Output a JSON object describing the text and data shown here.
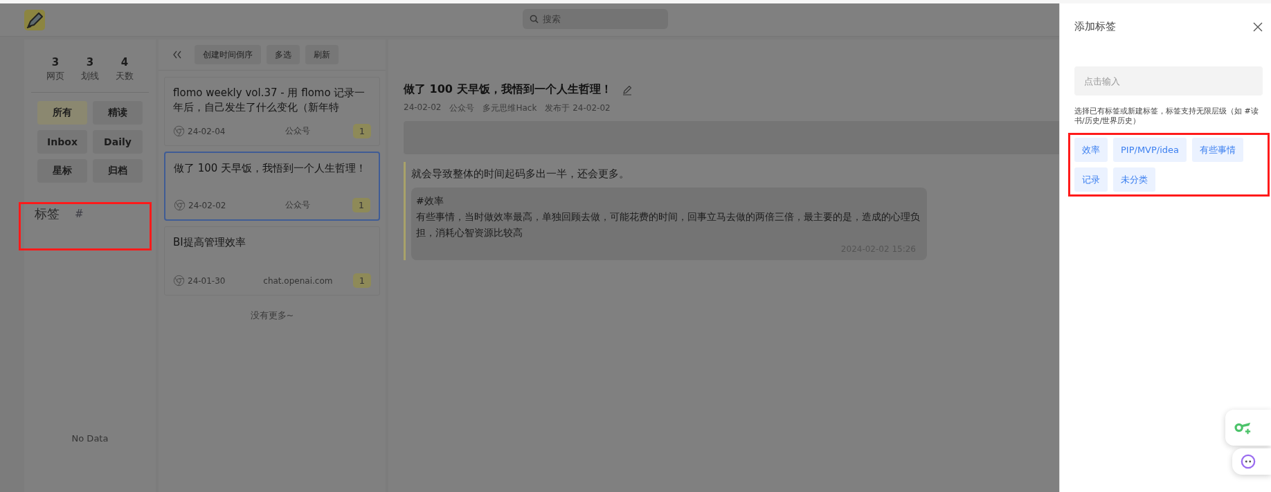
{
  "header": {
    "search": {
      "placeholder": "搜索"
    }
  },
  "sidebar": {
    "stats": [
      {
        "value": "3",
        "label": "网页"
      },
      {
        "value": "3",
        "label": "划线"
      },
      {
        "value": "4",
        "label": "天数"
      }
    ],
    "filters": [
      {
        "label": "所有",
        "selected": true
      },
      {
        "label": "精读",
        "selected": false
      },
      {
        "label": "Inbox",
        "selected": false
      },
      {
        "label": "Daily",
        "selected": false
      },
      {
        "label": "星标",
        "selected": false
      },
      {
        "label": "归档",
        "selected": false
      }
    ],
    "tags": {
      "title": "标签",
      "add": "#",
      "highlighted": true
    },
    "empty": "No Data"
  },
  "list": {
    "buttons": [
      "创建时间倒序",
      "多选",
      "刷新"
    ],
    "items": [
      {
        "title": "flomo weekly vol.37 - 用 flomo 记录一年后，自己发生了什么变化（新年特",
        "date": "24-02-04",
        "source": "公众号",
        "count": "1",
        "selected": false
      },
      {
        "title": "做了 100 天早饭，我悟到一个人生哲理！",
        "date": "24-02-02",
        "source": "公众号",
        "count": "1",
        "selected": true
      },
      {
        "title": "BI提高管理效率",
        "date": "24-01-30",
        "source": "chat.openai.com",
        "count": "1",
        "selected": false
      }
    ],
    "end": "没有更多~"
  },
  "article": {
    "title": "做了 100 天早饭，我悟到一个人生哲理！",
    "meta": [
      "24-02-02",
      "公众号",
      "多元思维Hack",
      "发布于 24-02-02"
    ],
    "highlight": {
      "quote": "就会导致整体的时间起码多出一半，还会更多。",
      "note_tag": "#效率",
      "note": "有些事情，当时做效率最高，单独回顾去做，可能花费的时间，回事立马去做的两倍三倍，最主要的是，造成的心理负担，消耗心智资源比较高",
      "time": "2024-02-02 15:26"
    }
  },
  "drawer": {
    "title": "添加标签",
    "input": {
      "placeholder": "点击输入"
    },
    "hint": "选择已有标签或新建标签，标签支持无限层级（如 #读书/历史/世界历史）",
    "highlighted": true,
    "tags": [
      "效率",
      "PIP/MVP/idea",
      "有些事情",
      "记录",
      "未分类"
    ]
  }
}
